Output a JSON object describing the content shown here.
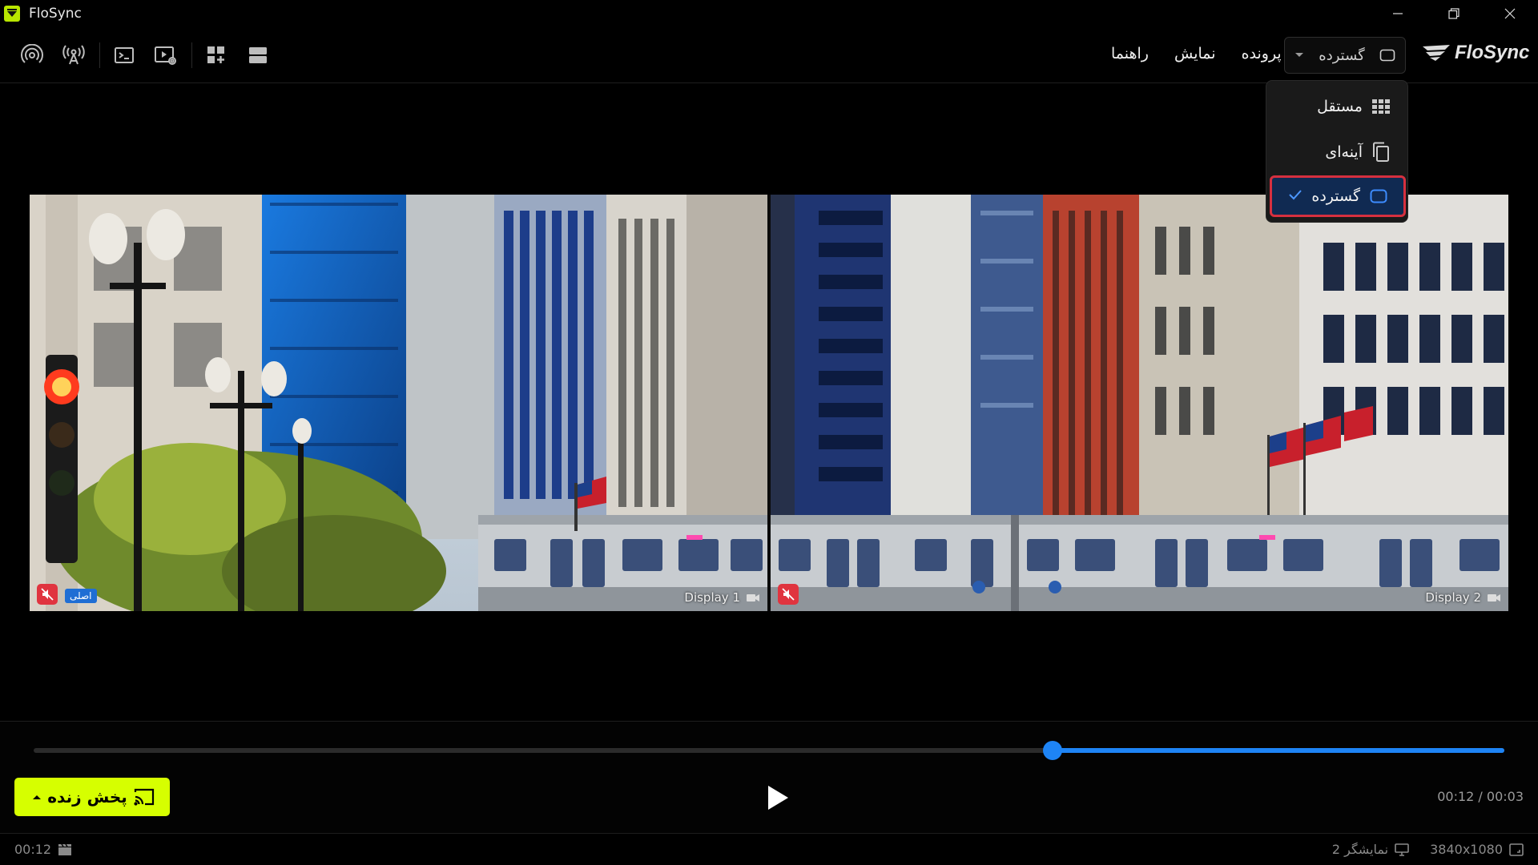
{
  "app": {
    "title": "FloSync",
    "brand": "FloSync"
  },
  "window_controls": [
    "minimize-icon",
    "restore-icon",
    "close-icon"
  ],
  "toolbar": {
    "icons": [
      "broadcast-icon",
      "antenna-icon",
      "terminal-icon",
      "video-settings-icon",
      "grid-add-icon",
      "rows-icon"
    ],
    "menu": {
      "file": "پرونده",
      "view": "نمایش",
      "help": "راهنما"
    },
    "mode_select": {
      "selected": "گسترده"
    }
  },
  "mode_dropdown": {
    "items": [
      {
        "label": "مستقل",
        "icon": "grid-icon",
        "selected": false
      },
      {
        "label": "آینه‌ای",
        "icon": "copy-icon",
        "selected": false
      },
      {
        "label": "گسترده",
        "icon": "screen-icon",
        "selected": true
      }
    ]
  },
  "preview": {
    "screens": [
      {
        "label": "Display 1",
        "badge": "اصلی",
        "muted": true
      },
      {
        "label": "Display 2",
        "badge": "",
        "muted": true
      }
    ]
  },
  "playback": {
    "progress": 0.693,
    "live_button": "پخش زنده",
    "time": "00:12 / 00:03"
  },
  "status": {
    "duration": "00:12",
    "displays": "2 نمایشگر",
    "resolution": "3840x1080"
  },
  "colors": {
    "accent_blue": "#1e84f5",
    "live_green": "#d6ff00",
    "selected_border": "#d6303f",
    "mute_red": "#e0343f"
  }
}
